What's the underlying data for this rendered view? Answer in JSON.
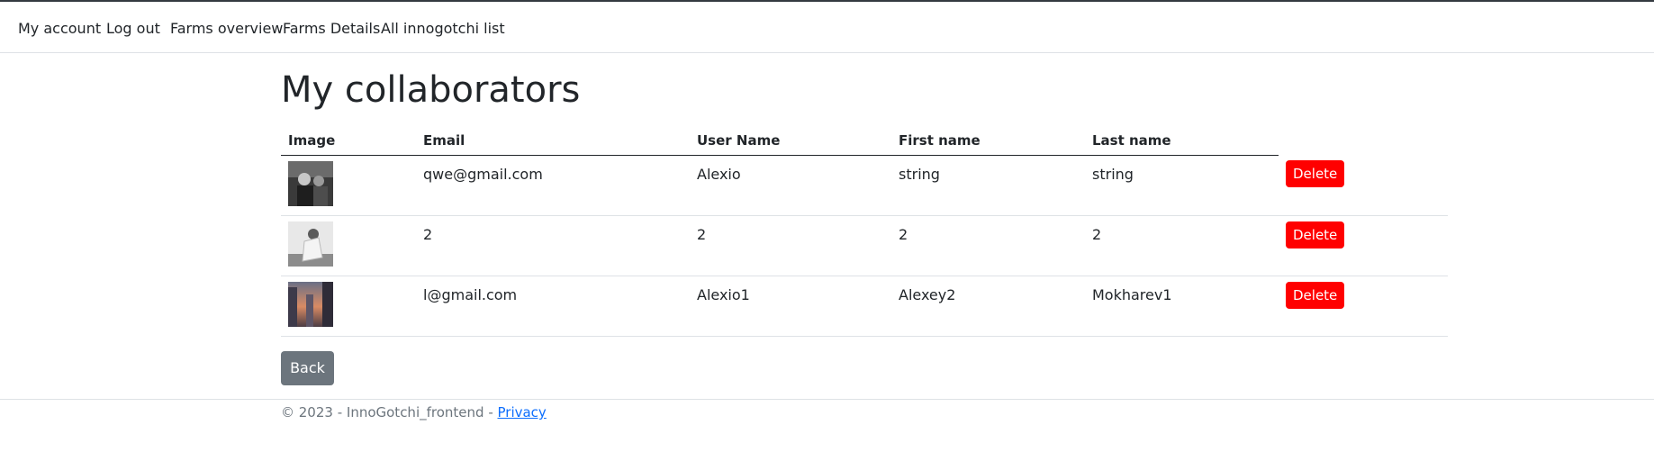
{
  "nav": {
    "items": [
      {
        "label": "My account"
      },
      {
        "label": "Log out"
      },
      {
        "label": "Farms overview"
      },
      {
        "label": "Farms Details"
      },
      {
        "label": "All innogotchi list"
      }
    ]
  },
  "page": {
    "title": "My collaborators"
  },
  "table": {
    "headers": [
      "Image",
      "Email",
      "User Name",
      "First name",
      "Last name"
    ],
    "rows": [
      {
        "email": "qwe@gmail.com",
        "user_name": "Alexio",
        "first_name": "string",
        "last_name": "string",
        "delete_label": "Delete"
      },
      {
        "email": "2",
        "user_name": "2",
        "first_name": "2",
        "last_name": "2",
        "delete_label": "Delete"
      },
      {
        "email": "l@gmail.com",
        "user_name": "Alexio1",
        "first_name": "Alexey2",
        "last_name": "Mokharev1",
        "delete_label": "Delete"
      }
    ]
  },
  "back_button": {
    "label": "Back"
  },
  "footer": {
    "text": "© 2023 - InnoGotchi_frontend - ",
    "privacy_link": "Privacy"
  },
  "colors": {
    "delete_button": "#ff0000",
    "back_button": "#6c757d",
    "link": "#0d6efd"
  }
}
